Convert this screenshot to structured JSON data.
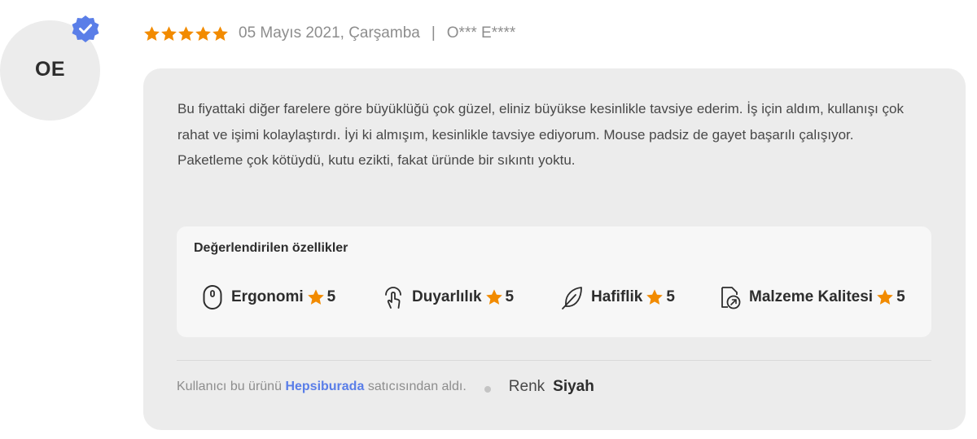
{
  "avatar": {
    "initials": "OE",
    "verified_icon": "verified-badge-icon",
    "badge_color": "#5a7ee8"
  },
  "review": {
    "rating": 5,
    "rating_max": 5,
    "date": "05 Mayıs 2021, Çarşamba",
    "separator": "|",
    "author": "O*** E****",
    "star_color": "#f28b00",
    "text_lines": [
      "Bu fiyattaki diğer farelere göre büyüklüğü çok güzel, eliniz büyükse kesinlikle tavsiye ederim. İş için aldım, kullanışı çok rahat ve işimi kolaylaştırdı. İyi ki almışım, kesinlikle tavsiye ediyorum. Mouse padsiz de gayet başarılı çalışıyor.",
      "Paketleme çok kötüydü, kutu ezikti, fakat üründe bir sıkıntı yoktu."
    ]
  },
  "features": {
    "title": "Değerlendirilen özellikler",
    "items": [
      {
        "icon": "mouse-icon",
        "label": "Ergonomi",
        "score": "5"
      },
      {
        "icon": "touch-hand-icon",
        "label": "Duyarlılık",
        "score": "5"
      },
      {
        "icon": "feather-icon",
        "label": "Hafiflik",
        "score": "5"
      },
      {
        "icon": "quality-badge-icon",
        "label": "Malzeme Kalitesi",
        "score": "5"
      }
    ]
  },
  "footer": {
    "purchase_prefix": "Kullanıcı bu ürünü",
    "seller": "Hepsiburada",
    "purchase_suffix": "satıcısından aldı.",
    "attribute_label": "Renk",
    "attribute_value": "Siyah",
    "seller_color": "#5a7ee8"
  }
}
